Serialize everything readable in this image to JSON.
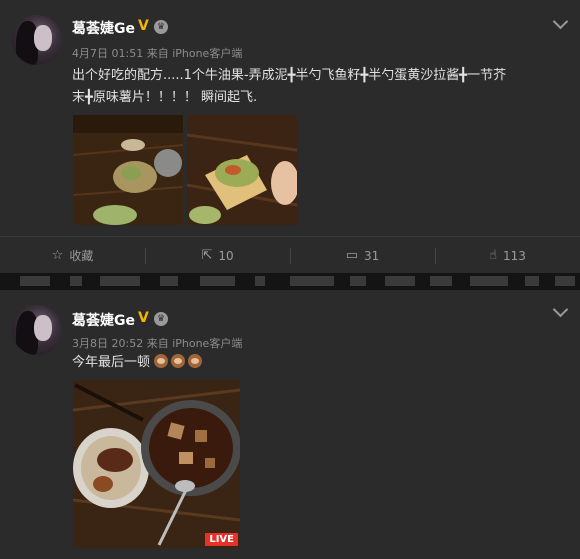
{
  "posts": [
    {
      "username": "葛荟婕Ge",
      "verified_badge": "V",
      "date": "4月7日 01:51",
      "source": "来自 iPhone客户端",
      "text_line1": "出个好吃的配方.....1个牛油果-弄成泥╋半勺飞鱼籽╋半勺蛋黄沙拉酱╋一节芥",
      "text_line2": "末╋原味薯片！！！！ 瞬间起飞.",
      "images": [
        "avocado-plate-photo",
        "avocado-chip-photo"
      ]
    },
    {
      "username": "葛荟婕Ge",
      "verified_badge": "V",
      "date": "3月8日 20:52",
      "source": "来自 iPhone客户端",
      "text": "今年最后一顿",
      "emojis": [
        "see-no-evil-monkey",
        "hear-no-evil-monkey",
        "speak-no-evil-monkey"
      ],
      "live_badge": "LIVE"
    }
  ],
  "actions": {
    "favorite_label": "收藏",
    "repost_count": "10",
    "comment_count": "31",
    "like_count": "113"
  },
  "colors": {
    "background": "#2b2b2b",
    "accent_badge": "#f7b500",
    "live_badge": "#e5332a"
  }
}
